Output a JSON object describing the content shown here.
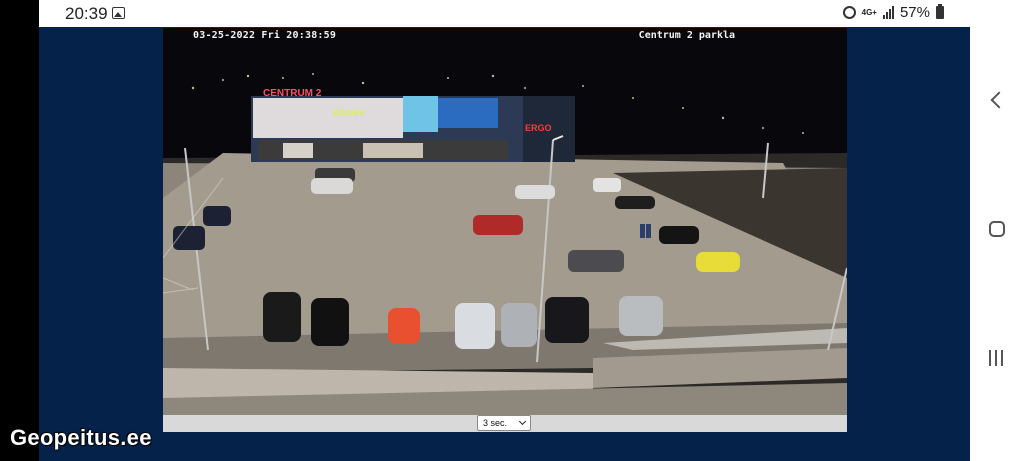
{
  "status_bar": {
    "time": "20:39",
    "gallery_icon": "image-icon",
    "alarm_icon": "alarm-icon",
    "network": "4G+",
    "signal_icon": "signal-icon",
    "battery": "57%"
  },
  "camera": {
    "timestamp": "03-25-2022 Fri 20:38:59",
    "name": "Centrum 2 parkla",
    "signs": {
      "mall": "CENTRUM 2",
      "shop": "KRABA",
      "bank": "ERGO"
    }
  },
  "controls": {
    "interval": "3 sec."
  },
  "watermark": "Geopeitus.ee",
  "nav": {
    "back_icon": "back-icon",
    "home_icon": "home-icon",
    "recent_icon": "recent-apps-icon"
  }
}
